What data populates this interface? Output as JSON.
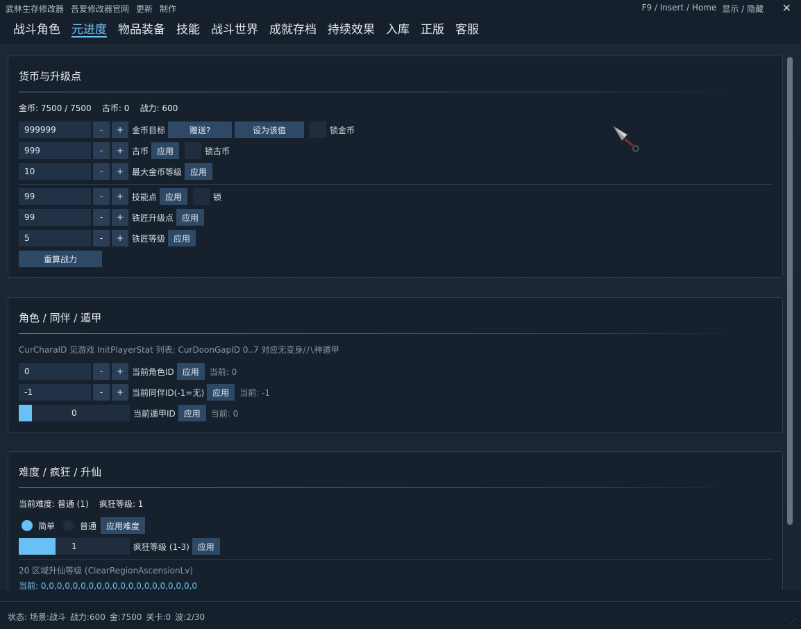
{
  "topbar": {
    "menu": [
      "武林生存修改器",
      "吾爱修改器官网",
      "更新",
      "制作"
    ],
    "hotkey": "F9 / Insert / Home",
    "toggle": "显示 / 隐藏",
    "close": "✕"
  },
  "tabs": [
    {
      "label": "战斗角色"
    },
    {
      "label": "元进度"
    },
    {
      "label": "物品装备"
    },
    {
      "label": "技能"
    },
    {
      "label": "战斗世界"
    },
    {
      "label": "成就存档"
    },
    {
      "label": "持续效果"
    },
    {
      "label": "入库"
    },
    {
      "label": "正版"
    },
    {
      "label": "客服"
    }
  ],
  "active_tab": "元进度",
  "currency": {
    "title": "货币与升级点",
    "stats": {
      "gold": "金币: 7500 / 7500",
      "ancient": "古币: 0",
      "power": "战力: 600"
    },
    "rows": [
      {
        "value": "999999",
        "label": "金币目标",
        "gift": "赠送?",
        "setval": "设为该值",
        "lock": "锁金币"
      },
      {
        "value": "999",
        "label": "古币",
        "apply": "应用",
        "lock": "锁古币"
      },
      {
        "value": "10",
        "label": "最大金币等级",
        "apply": "应用"
      },
      {
        "value": "99",
        "label": "技能点",
        "apply": "应用",
        "lock": "锁"
      },
      {
        "value": "99",
        "label": "铁匠升级点",
        "apply": "应用"
      },
      {
        "value": "5",
        "label": "铁匠等级",
        "apply": "应用"
      }
    ],
    "recalc": "重算战力",
    "minus": "-",
    "plus": "+"
  },
  "character": {
    "title": "角色 / 同伴 / 遁甲",
    "note": "CurCharaID 见游戏 InitPlayerStat 列表; CurDoonGapID 0..7 对应无变身/八种遁甲",
    "rows": [
      {
        "value": "0",
        "label": "当前角色ID",
        "apply": "应用",
        "current": "当前: 0"
      },
      {
        "value": "-1",
        "label": "当前同伴ID(-1=无)",
        "apply": "应用",
        "current": "当前: -1"
      }
    ],
    "doongap": {
      "value": "0",
      "fill": 0.12,
      "label": "当前遁甲ID",
      "apply": "应用",
      "current": "当前: 0"
    }
  },
  "difficulty": {
    "title": "难度 / 疯狂 / 升仙",
    "stats": {
      "current": "当前难度: 普通 (1)",
      "madness": "疯狂等级: 1"
    },
    "options": [
      {
        "label": "简单",
        "selected": true
      },
      {
        "label": "普通",
        "selected": false
      }
    ],
    "apply_diff": "应用难度",
    "madness_slider": {
      "value": "1",
      "fill": 0.33,
      "label": "疯狂等级 (1-3)",
      "apply": "应用"
    },
    "ascension_note": "20 区域升仙等级 (ClearRegionAscensionLv)",
    "ascension_current": "当前: 0,0,0,0,0,0,0,0,0,0,0,0,0,0,0,0,0,0,0,0"
  },
  "statusbar": {
    "items": [
      "状态: 场景:战斗",
      "战力:600",
      "金:7500",
      "关卡:0",
      "波:2/30"
    ]
  },
  "colors": {
    "accent": "#6cc4f4",
    "bg": "#16202c",
    "button": "#2d4966"
  }
}
